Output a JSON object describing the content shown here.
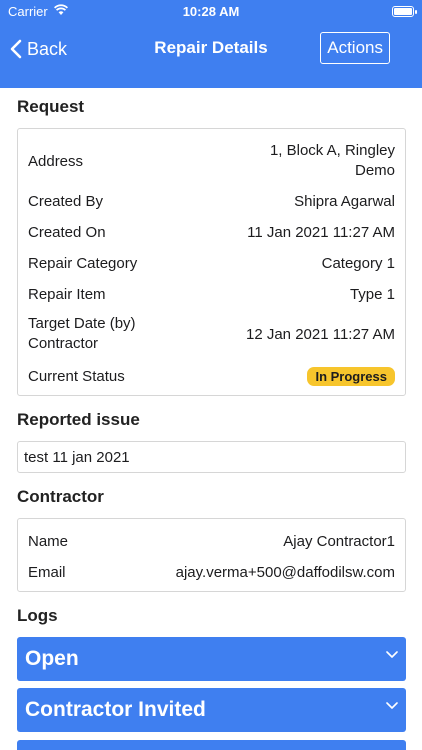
{
  "status_bar": {
    "carrier": "Carrier",
    "time": "10:28 AM"
  },
  "nav": {
    "back_label": "Back",
    "title": "Repair Details",
    "actions_label": "Actions"
  },
  "request": {
    "title": "Request",
    "rows": [
      {
        "label": "Address",
        "value": "1, Block A, Ringley Demo"
      },
      {
        "label": "Created By",
        "value": "Shipra Agarwal"
      },
      {
        "label": "Created On",
        "value": "11 Jan 2021 11:27 AM"
      },
      {
        "label": "Repair Category",
        "value": "Category 1"
      },
      {
        "label": "Repair Item",
        "value": "Type 1"
      },
      {
        "label": "Target Date (by) Contractor",
        "value": "12 Jan 2021 11:27 AM"
      },
      {
        "label": "Current Status",
        "value": "In Progress"
      }
    ]
  },
  "issue": {
    "title": "Reported issue",
    "text": "test 11 jan 2021"
  },
  "contractor": {
    "title": "Contractor",
    "rows": [
      {
        "label": "Name",
        "value": "Ajay Contractor1"
      },
      {
        "label": "Email",
        "value": "ajay.verma+500@daffodilsw.com"
      }
    ]
  },
  "logs": {
    "title": "Logs",
    "items": [
      {
        "label": "Open"
      },
      {
        "label": "Contractor Invited"
      },
      {
        "label": ""
      }
    ]
  },
  "colors": {
    "primary": "#3f7ff0",
    "status_badge": "#f7c52c"
  },
  "icons": [
    "wifi-icon",
    "battery-icon",
    "back-chevron-icon",
    "chevron-down-icon"
  ]
}
